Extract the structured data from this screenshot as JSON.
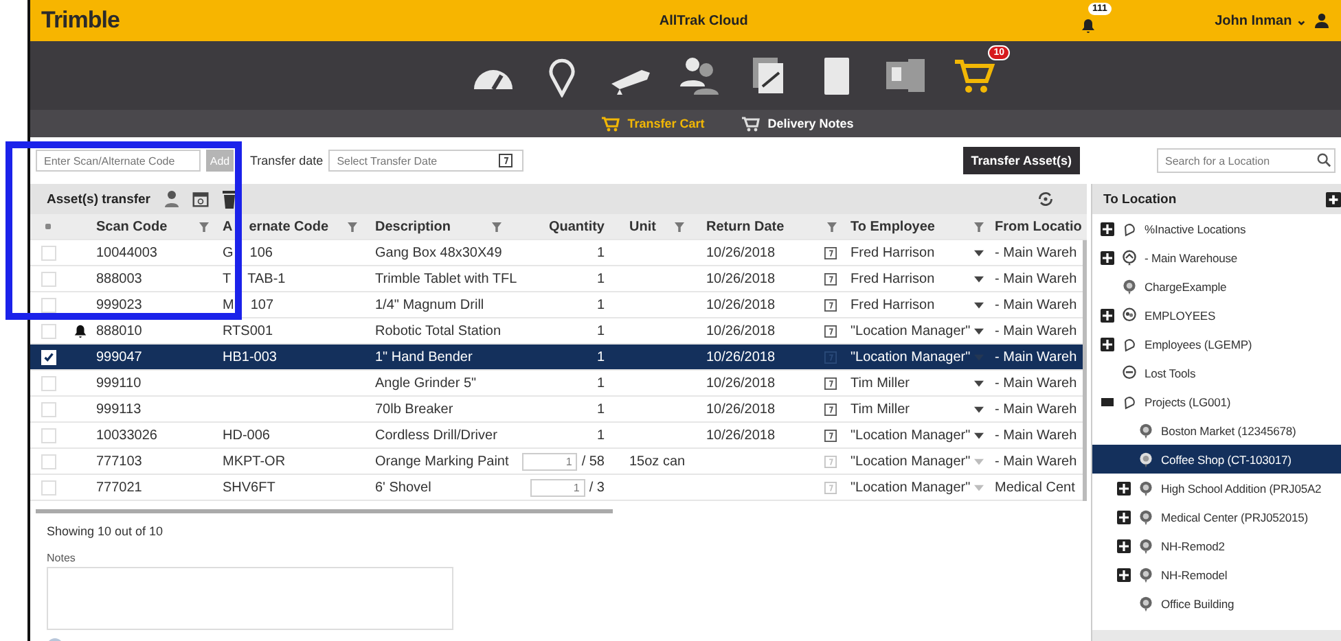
{
  "header": {
    "logo": "Trimble",
    "title": "AllTrak Cloud",
    "notifications": "111",
    "user": "John Inman ⌄"
  },
  "nav": [
    {
      "selected": false
    },
    {
      "selected": false
    },
    {
      "selected": false
    },
    {
      "selected": false
    },
    {
      "selected": false
    },
    {
      "selected": false
    },
    {
      "selected": false
    },
    {
      "selected": true,
      "badge": "10"
    }
  ],
  "subnav": [
    {
      "label": "Transfer Cart",
      "selected": true
    },
    {
      "label": "Delivery Notes",
      "selected": false
    }
  ],
  "toolbar": {
    "scan_placeholder": "Enter Scan/Alternate Code",
    "add": "Add",
    "date_label": "Transfer date",
    "date_placeholder": "Select Transfer Date",
    "transfer": "Transfer Asset(s)"
  },
  "grid": {
    "title": "Asset(s) transfer",
    "select_all_checked": false,
    "columns": [
      {
        "parts": [
          "Scan Code"
        ],
        "filter": true
      },
      {
        "parts": [
          "A",
          "ernate Code"
        ],
        "filter": true
      },
      {
        "parts": [
          "Description"
        ],
        "filter": true
      },
      {
        "parts": [
          "Quantity"
        ],
        "filter": false
      },
      {
        "parts": [
          "Unit"
        ],
        "filter": true
      },
      {
        "parts": [
          "Return Date"
        ],
        "filter": true
      },
      {
        "parts": [
          "To Employee"
        ],
        "filter": true
      },
      {
        "parts": [
          "From Locatio"
        ],
        "filter": false
      }
    ],
    "rows": [
      {
        "kind": "asset",
        "selected": false,
        "alert": false,
        "scan": "10044003",
        "alt": [
          "G",
          "106"
        ],
        "desc": "Gang Box 48x30X49",
        "qty": "1",
        "date": "10/26/2018",
        "employee": "Fred Harrison",
        "from": "- Main Wareh"
      },
      {
        "kind": "asset",
        "selected": false,
        "alert": false,
        "scan": "888003",
        "alt": [
          "T",
          "TAB-1"
        ],
        "desc": "Trimble Tablet with TFL",
        "qty": "1",
        "date": "10/26/2018",
        "employee": "Fred Harrison",
        "from": "- Main Wareh"
      },
      {
        "kind": "asset",
        "selected": false,
        "alert": false,
        "scan": "999023",
        "alt": [
          "M",
          "107"
        ],
        "desc": "1/4\" Magnum Drill",
        "qty": "1",
        "date": "10/26/2018",
        "employee": "Fred Harrison",
        "from": "- Main Wareh"
      },
      {
        "kind": "asset",
        "selected": false,
        "alert": true,
        "scan": "888010",
        "alt": [
          "RTS001"
        ],
        "desc": "Robotic Total Station",
        "qty": "1",
        "date": "10/26/2018",
        "employee": "\"Location Manager\"",
        "from": "- Main Wareh"
      },
      {
        "kind": "asset",
        "selected": true,
        "alert": false,
        "scan": "999047",
        "alt": [
          "HB1-003"
        ],
        "desc": "1\" Hand Bender",
        "qty": "1",
        "date": "10/26/2018",
        "employee": "\"Location Manager\"",
        "from": "- Main Wareh"
      },
      {
        "kind": "asset",
        "selected": false,
        "alert": false,
        "scan": "999110",
        "desc": "Angle Grinder 5\"",
        "qty": "1",
        "date": "10/26/2018",
        "employee": "Tim Miller",
        "from": "- Main Wareh"
      },
      {
        "kind": "asset",
        "selected": false,
        "alert": false,
        "scan": "999113",
        "desc": "70lb Breaker",
        "qty": "1",
        "date": "10/26/2018",
        "employee": "Tim Miller",
        "from": "- Main Wareh"
      },
      {
        "kind": "asset",
        "selected": false,
        "alert": false,
        "scan": "10033026",
        "alt": [
          "HD-006"
        ],
        "desc": "Cordless Drill/Driver",
        "qty": "1",
        "date": "10/26/2018",
        "employee": "\"Location Manager\"",
        "from": "- Main Wareh"
      },
      {
        "kind": "bulk",
        "selected": false,
        "alert": false,
        "scan": "777103",
        "alt": [
          "MKPT-OR"
        ],
        "desc": "Orange Marking Paint",
        "qty": "1",
        "of": "/ 58",
        "unit": "15oz can",
        "employee": "\"Location Manager\"",
        "from": "- Main Wareh"
      },
      {
        "kind": "bulk",
        "selected": false,
        "alert": false,
        "scan": "777021",
        "alt": [
          "SHV6FT"
        ],
        "desc": "6' Shovel",
        "qty": "1",
        "of": "/ 3",
        "employee": "\"Location Manager\"",
        "from": "Medical Cent"
      }
    ],
    "footer": "Showing 10 out of 10",
    "notes_label": "Notes"
  },
  "locations": {
    "search_placeholder": "Search for a Location",
    "title": "To Location",
    "tree": [
      {
        "label": "%Inactive Locations",
        "kind": "group",
        "expanded": false,
        "selected": false
      },
      {
        "label": "- Main Warehouse",
        "kind": "warehouse",
        "expanded": false,
        "selected": false
      },
      {
        "label": "ChargeExample",
        "kind": "site",
        "selected": false
      },
      {
        "label": "EMPLOYEES",
        "kind": "people",
        "expanded": false,
        "selected": false
      },
      {
        "label": "Employees (LGEMP)",
        "kind": "group",
        "expanded": false,
        "selected": false
      },
      {
        "label": "Lost Tools",
        "kind": "lost",
        "selected": false
      },
      {
        "label": "Projects (LG001)",
        "kind": "group",
        "expanded": true,
        "selected": false,
        "children": [
          {
            "label": "Boston Market (12345678)",
            "kind": "site",
            "selected": false
          },
          {
            "label": "Coffee Shop (CT-103017)",
            "kind": "site",
            "selected": true
          },
          {
            "label": "High School Addition (PRJ05A2",
            "kind": "site",
            "expanded": false,
            "selected": false
          },
          {
            "label": "Medical Center (PRJ052015)",
            "kind": "site",
            "expanded": false,
            "selected": false
          },
          {
            "label": "NH-Remod2",
            "kind": "site",
            "expanded": false,
            "selected": false
          },
          {
            "label": "NH-Remodel",
            "kind": "site",
            "expanded": false,
            "selected": false
          },
          {
            "label": "Office Building",
            "kind": "site",
            "selected": false
          }
        ]
      }
    ]
  }
}
